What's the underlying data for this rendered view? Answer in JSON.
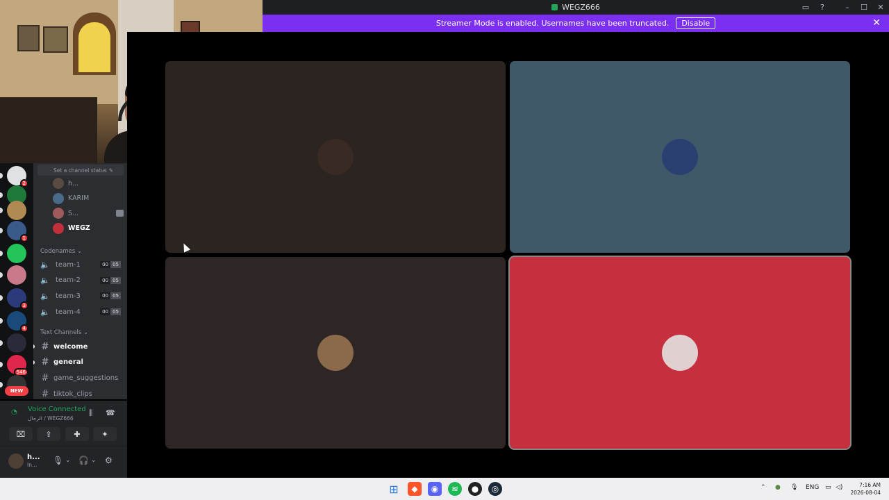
{
  "window": {
    "title": "WEGZ666"
  },
  "banner": {
    "text": "Streamer Mode is enabled. Usernames have been truncated.",
    "disable_label": "Disable",
    "color": "#7b2ff0"
  },
  "servers": [
    {
      "color": "#dfe1e5",
      "badge": "2"
    },
    {
      "color": "#1f7a3a",
      "badge": ""
    },
    {
      "color": "#b08a52",
      "badge": ""
    },
    {
      "color": "#3a5a8a",
      "badge": "1"
    },
    {
      "color": "#23c45a",
      "badge": ""
    },
    {
      "color": "#c87a8a",
      "badge": ""
    },
    {
      "color": "#2a3a7a",
      "badge": "3"
    },
    {
      "color": "#1a4a7a",
      "badge": "4"
    },
    {
      "color": "#2a2a3a",
      "badge": ""
    },
    {
      "color": "#e0264a",
      "badge": "546"
    },
    {
      "color": "#333",
      "badge": ""
    }
  ],
  "new_badge": "NEW",
  "voice": {
    "status_placeholder": "Set a channel status",
    "members": [
      {
        "name": "h...",
        "color": "#5a4a40",
        "self": false
      },
      {
        "name": "KARIM",
        "color": "#4a6a8a",
        "self": false
      },
      {
        "name": "S...",
        "color": "#a05a5a",
        "self": false
      },
      {
        "name": "WEGZ",
        "color": "#c0303a",
        "self": true
      }
    ]
  },
  "codenames": {
    "category": "Codenames",
    "channels": [
      {
        "name": "team-1",
        "count": "00",
        "limit": "05"
      },
      {
        "name": "team-2",
        "count": "00",
        "limit": "05"
      },
      {
        "name": "team-3",
        "count": "00",
        "limit": "05"
      },
      {
        "name": "team-4",
        "count": "00",
        "limit": "05"
      }
    ]
  },
  "text_channels": {
    "category": "Text Channels",
    "channels": [
      {
        "name": "welcome",
        "unread": true
      },
      {
        "name": "general",
        "unread": true
      },
      {
        "name": "game_suggestions",
        "unread": false
      },
      {
        "name": "tiktok_clips",
        "unread": false
      }
    ]
  },
  "voice_connected": {
    "title": "Voice Connected",
    "subtitle": "الرجال / WEGZ666"
  },
  "user": {
    "name": "h...",
    "status": "In..."
  },
  "tiles": [
    {
      "bg": "#2b2420",
      "avatar": "#3a2a24"
    },
    {
      "bg": "#3f5968",
      "avatar": "#2a4070"
    },
    {
      "bg": "#2d2624",
      "avatar": "#8a6a4a"
    },
    {
      "bg": "#c6303e",
      "avatar": "#e0d0d0",
      "speaking": true
    }
  ],
  "taskbar": {
    "lang": "ENG",
    "time": "7:16 AM",
    "date": "2026-08-04"
  }
}
